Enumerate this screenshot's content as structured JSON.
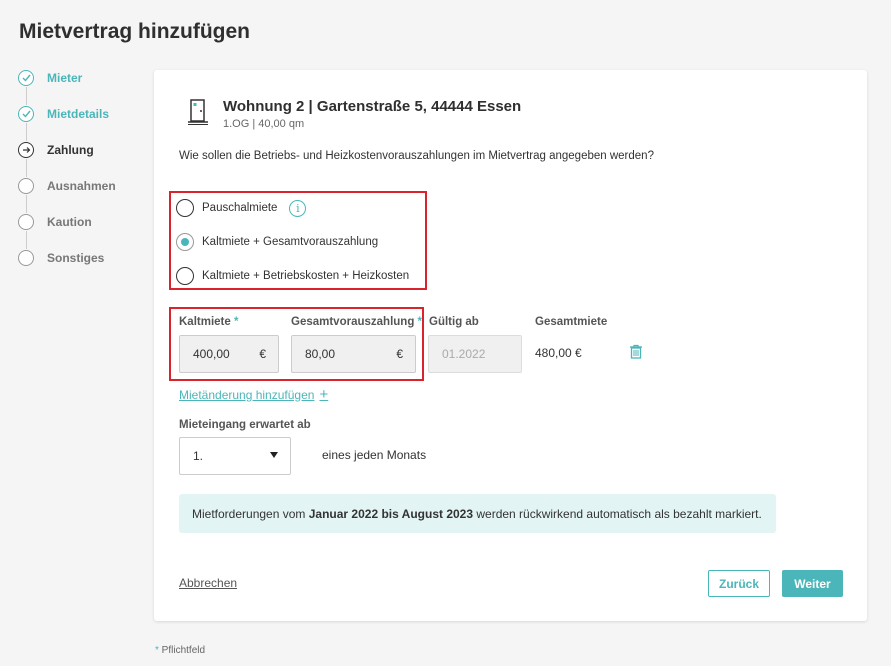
{
  "page": {
    "title": "Mietvertrag hinzufügen"
  },
  "stepper": [
    {
      "label": "Mieter",
      "state": "done"
    },
    {
      "label": "Mietdetails",
      "state": "done"
    },
    {
      "label": "Zahlung",
      "state": "current"
    },
    {
      "label": "Ausnahmen",
      "state": "todo"
    },
    {
      "label": "Kaution",
      "state": "todo"
    },
    {
      "label": "Sonstiges",
      "state": "todo"
    }
  ],
  "property": {
    "title": "Wohnung 2 | Gartenstraße 5, 44444 Essen",
    "subtitle": "1.OG | 40,00 qm",
    "icon": "door-icon"
  },
  "question": "Wie sollen die Betriebs- und Heizkostenvorauszahlungen im Mietvertrag angegeben werden?",
  "options": [
    {
      "label": "Pauschalmiete",
      "checked": false
    },
    {
      "label": "Kaltmiete + Gesamtvorauszahlung",
      "checked": true
    },
    {
      "label": "Kaltmiete + Betriebskosten + Heizkosten",
      "checked": false
    }
  ],
  "fields": {
    "kaltmiete": {
      "label": "Kaltmiete",
      "required": "*",
      "value": "400,00",
      "currency": "€"
    },
    "gesamtvorauszahlung": {
      "label": "Gesamtvorauszahlung",
      "required": "*",
      "value": "80,00",
      "currency": "€"
    },
    "gueltig_ab": {
      "label": "Gültig ab",
      "placeholder": "01.2022"
    },
    "gesamtmiete": {
      "label": "Gesamtmiete",
      "value": "480,00 €"
    }
  },
  "add_change_label": "Mietänderung hinzufügen",
  "payment_expected": {
    "label": "Mieteingang erwartet ab",
    "value": "1.",
    "suffix": "eines jeden Monats"
  },
  "notice": {
    "prefix": "Mietforderungen vom ",
    "bold": "Januar 2022 bis August 2023",
    "suffix": " werden rückwirkend automatisch als bezahlt markiert."
  },
  "actions": {
    "cancel": "Abbrechen",
    "back": "Zurück",
    "next": "Weiter"
  },
  "footnote": {
    "star": "*",
    "text": " Pflichtfeld"
  },
  "colors": {
    "accent": "#4bb6b9",
    "highlight": "#d9232d",
    "notice_bg": "#e3f4f5"
  }
}
